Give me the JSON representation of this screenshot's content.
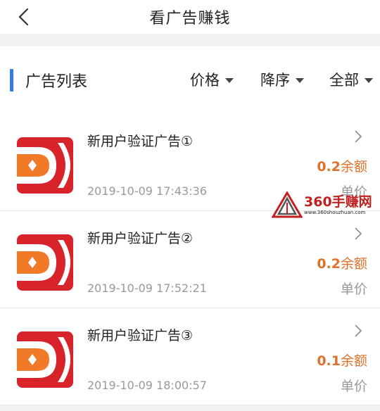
{
  "header": {
    "title": "看广告赚钱",
    "back_icon": "chevron-left-icon"
  },
  "list_header": {
    "title": "广告列表",
    "accent_color": "#2f7cf0",
    "filters": [
      {
        "label": "价格",
        "icon": "caret-down-icon"
      },
      {
        "label": "降序",
        "icon": "caret-down-icon"
      },
      {
        "label": "全部",
        "icon": "caret-down-icon"
      }
    ]
  },
  "items": [
    {
      "name": "新用户验证广告①",
      "time": "2019-10-09 17:43:36",
      "amount": "0.2",
      "amount_suffix": "余额",
      "unit_label": "单价"
    },
    {
      "name": "新用户验证广告②",
      "time": "2019-10-09 17:52:21",
      "amount": "0.2",
      "amount_suffix": "余额",
      "unit_label": "单价"
    },
    {
      "name": "新用户验证广告③",
      "time": "2019-10-09 18:00:57",
      "amount": "0.1",
      "amount_suffix": "余额",
      "unit_label": "单价"
    }
  ],
  "watermark": {
    "name": "360手赚网",
    "url": "www.360shouzhuan.com"
  },
  "colors": {
    "amount": "#e0702a",
    "logo_red": "#d8232a",
    "logo_orange": "#f07a28"
  }
}
